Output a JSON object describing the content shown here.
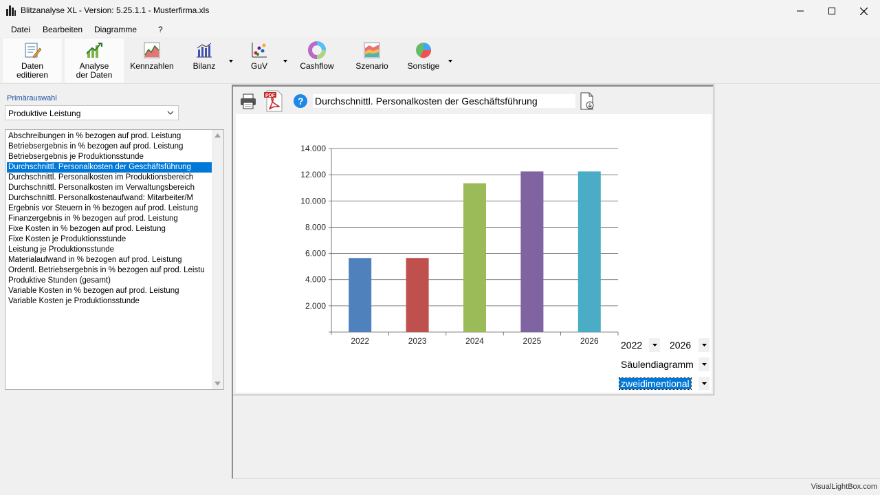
{
  "window": {
    "title": "Blitzanalyse XL - Version: 5.25.1.1 - Musterfirma.xls"
  },
  "menu": {
    "items": [
      {
        "label": "Datei"
      },
      {
        "label": "Bearbeiten"
      },
      {
        "label": "Diagramme"
      },
      {
        "label": "?"
      }
    ]
  },
  "toolbar": {
    "daten_editieren": "Daten\neditieren",
    "analyse_der_daten": "Analyse\nder Daten",
    "kennzahlen": "Kennzahlen",
    "bilanz": "Bilanz",
    "guv": "GuV",
    "cashflow": "Cashflow",
    "szenario": "Szenario",
    "sonstige": "Sonstige"
  },
  "left": {
    "primary_label": "Primärauswahl",
    "primary_value": "Produktive Leistung",
    "items": [
      "Abschreibungen in % bezogen auf prod. Leistung",
      "Betriebsergebnis in % bezogen auf prod. Leistung",
      "Betriebsergebnis je Produktionsstunde",
      "Durchschnittl. Personalkosten der Geschäftsführung",
      "Durchschnittl. Personalkosten im Produktionsbereich",
      "Durchschnittl. Personalkosten im Verwaltungsbereich",
      "Durchschnittl. Personalkostenaufwand: Mitarbeiter/M",
      "Ergebnis vor Steuern in % bezogen auf prod. Leistung",
      "Finanzergebnis in % bezogen auf prod. Leistung",
      "Fixe Kosten in % bezogen auf prod. Leistung",
      "Fixe Kosten je Produktionsstunde",
      "Leistung je Produktionsstunde",
      "Materialaufwand in % bezogen auf prod. Leistung",
      "Ordentl. Betriebsergebnis in % bezogen auf prod. Leistu",
      "Produktive Stunden (gesamt)",
      "Variable Kosten in % bezogen auf prod. Leistung",
      "Variable Kosten je Produktionsstunde"
    ],
    "selected_index": 3
  },
  "chart_panel": {
    "title": "Durchschnittl. Personalkosten der Geschäftsführung",
    "year_from": "2022",
    "year_to": "2026",
    "chart_type": "Säulendiagramm",
    "dimension": "zweidimentional"
  },
  "chart_data": {
    "type": "bar",
    "title": "",
    "xlabel": "",
    "ylabel": "",
    "categories": [
      "2022",
      "2023",
      "2024",
      "2025",
      "2026"
    ],
    "values": [
      5650,
      5650,
      11350,
      12250,
      12250
    ],
    "colors": [
      "#4f81bd",
      "#c0504d",
      "#9bbb59",
      "#8064a2",
      "#4bacc6"
    ],
    "ylim": [
      0,
      14000
    ],
    "yticks": [
      "2.000",
      "4.000",
      "6.000",
      "8.000",
      "10.000",
      "12.000",
      "14.000"
    ],
    "grid": true
  },
  "status": {
    "text": "VisualLightBox.com"
  }
}
